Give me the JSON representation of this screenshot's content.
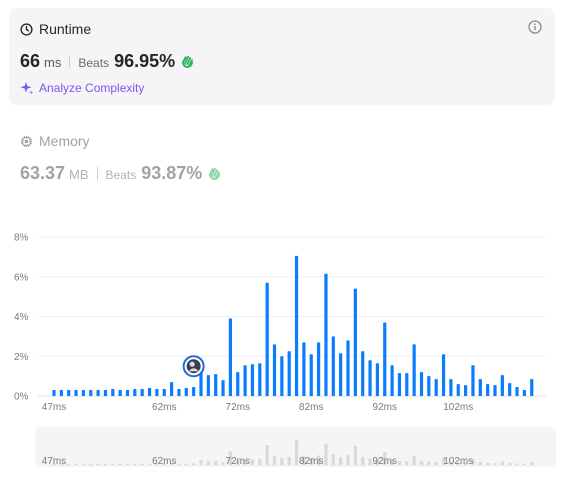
{
  "runtime": {
    "title": "Runtime",
    "value": "66",
    "unit": "ms",
    "beats_label": "Beats",
    "beats_value": "96.95%",
    "analyze_label": "Analyze Complexity"
  },
  "memory": {
    "title": "Memory",
    "value": "63.37",
    "unit": "MB",
    "beats_label": "Beats",
    "beats_value": "93.87%"
  },
  "colors": {
    "bar": "#0a7cff",
    "accent_green": "#2db55d",
    "link_purple": "#7e56e8",
    "nav_bar": "#d9d9d9"
  },
  "chart_data": {
    "type": "bar",
    "xlabel": "",
    "ylabel": "",
    "ylim": [
      0,
      8
    ],
    "y_ticks": [
      "0%",
      "2%",
      "4%",
      "6%",
      "8%"
    ],
    "x_ticks": [
      "47ms",
      "62ms",
      "72ms",
      "82ms",
      "92ms",
      "102ms"
    ],
    "x_tick_values": [
      47,
      62,
      72,
      82,
      92,
      102
    ],
    "grid": true,
    "highlight_x": 66,
    "bars": [
      {
        "x": 47,
        "y": 0.3
      },
      {
        "x": 48,
        "y": 0.3
      },
      {
        "x": 49,
        "y": 0.3
      },
      {
        "x": 50,
        "y": 0.3
      },
      {
        "x": 51,
        "y": 0.3
      },
      {
        "x": 52,
        "y": 0.3
      },
      {
        "x": 53,
        "y": 0.3
      },
      {
        "x": 54,
        "y": 0.3
      },
      {
        "x": 55,
        "y": 0.35
      },
      {
        "x": 56,
        "y": 0.3
      },
      {
        "x": 57,
        "y": 0.3
      },
      {
        "x": 58,
        "y": 0.35
      },
      {
        "x": 59,
        "y": 0.35
      },
      {
        "x": 60,
        "y": 0.4
      },
      {
        "x": 61,
        "y": 0.35
      },
      {
        "x": 62,
        "y": 0.35
      },
      {
        "x": 63,
        "y": 0.7
      },
      {
        "x": 64,
        "y": 0.35
      },
      {
        "x": 65,
        "y": 0.4
      },
      {
        "x": 66,
        "y": 0.45
      },
      {
        "x": 67,
        "y": 1.4
      },
      {
        "x": 68,
        "y": 1.05
      },
      {
        "x": 69,
        "y": 1.1
      },
      {
        "x": 70,
        "y": 0.8
      },
      {
        "x": 71,
        "y": 3.9
      },
      {
        "x": 72,
        "y": 1.2
      },
      {
        "x": 73,
        "y": 1.55
      },
      {
        "x": 74,
        "y": 1.6
      },
      {
        "x": 75,
        "y": 1.65
      },
      {
        "x": 76,
        "y": 5.7
      },
      {
        "x": 77,
        "y": 2.6
      },
      {
        "x": 78,
        "y": 2.0
      },
      {
        "x": 79,
        "y": 2.25
      },
      {
        "x": 80,
        "y": 7.05
      },
      {
        "x": 81,
        "y": 2.7
      },
      {
        "x": 82,
        "y": 2.1
      },
      {
        "x": 83,
        "y": 2.7
      },
      {
        "x": 84,
        "y": 6.15
      },
      {
        "x": 85,
        "y": 3.0
      },
      {
        "x": 86,
        "y": 2.15
      },
      {
        "x": 87,
        "y": 2.8
      },
      {
        "x": 88,
        "y": 5.4
      },
      {
        "x": 89,
        "y": 2.25
      },
      {
        "x": 90,
        "y": 1.8
      },
      {
        "x": 91,
        "y": 1.65
      },
      {
        "x": 92,
        "y": 3.7
      },
      {
        "x": 93,
        "y": 1.55
      },
      {
        "x": 94,
        "y": 1.15
      },
      {
        "x": 95,
        "y": 1.15
      },
      {
        "x": 96,
        "y": 2.6
      },
      {
        "x": 97,
        "y": 1.2
      },
      {
        "x": 98,
        "y": 1.0
      },
      {
        "x": 99,
        "y": 0.85
      },
      {
        "x": 100,
        "y": 2.1
      },
      {
        "x": 101,
        "y": 0.85
      },
      {
        "x": 102,
        "y": 0.6
      },
      {
        "x": 103,
        "y": 0.55
      },
      {
        "x": 104,
        "y": 1.55
      },
      {
        "x": 105,
        "y": 0.85
      },
      {
        "x": 106,
        "y": 0.6
      },
      {
        "x": 107,
        "y": 0.55
      },
      {
        "x": 108,
        "y": 1.05
      },
      {
        "x": 109,
        "y": 0.65
      },
      {
        "x": 110,
        "y": 0.45
      },
      {
        "x": 111,
        "y": 0.3
      },
      {
        "x": 112,
        "y": 0.85
      }
    ]
  }
}
